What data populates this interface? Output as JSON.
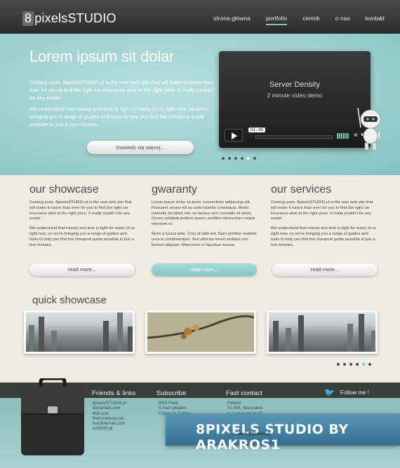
{
  "header": {
    "logo_number": "8",
    "logo_text": "pixelsSTUDIO",
    "nav": [
      {
        "label": "strona główna",
        "active": false
      },
      {
        "label": "portfolio",
        "active": true
      },
      {
        "label": "cennik",
        "active": false
      },
      {
        "label": "o nas",
        "active": false
      },
      {
        "label": "kontakt",
        "active": false
      }
    ]
  },
  "hero": {
    "title": "Lorem ipsum sit dolar",
    "p1": "Coming soon, 8pixelsSTUDIO.pl is the new web site that will make it easier than ever for you to find the right car insurance deal at the right price. It really couldn't be any easier.",
    "p2": "We understand that money and time is tight for many of us right now, so we're bringing you a range of guides and tools to help you find the cheapest quote possible in just a few minutes.",
    "cta": "Dowiedz się więcej...",
    "video": {
      "title": "Server Density",
      "subtitle": "2 minute video demo",
      "time": "01:48",
      "brand": "vi..."
    },
    "slider_dots": 6,
    "active_dot": 5
  },
  "columns": [
    {
      "title": "our showcase",
      "p1": "Coming soon, 8pixelsSTUDIO.pl is the new web site that will make it easier than ever for you to find the right car insurance deal at the right price. It really couldn't be any easier.",
      "p2": "We understand that money and time is tight for many of us right now, so we're bringing you a range of guides and tools to help you find the cheapest quote possible in just a few minutes.",
      "button": "read more..."
    },
    {
      "title": "gwaranty",
      "p1": "Lorem ipsum dolor sit amet, consectetur adipiscing elit. Praesent ornare elit eu ante lobortis consequat. Morbi molestie tincidunt nisi, eu lacinia sem convallis sit amet. Donec volutpat pretium ipsum, porttitor elementum neque interdum ut.",
      "p2": "Nunc a luctus ante. Cras id nibh est. Nam porttitor sodales urna in condimentum. Sed ultricies lorem sodales orci laoreet aliquam. Maecenas in faucibus massa.",
      "button": "read more..."
    },
    {
      "title": "our services",
      "p1": "Coming soon, 8pixelsSTUDIO.pl is the new web site that will make it easier than ever for you to find the right car insurance deal at the right price. It really couldn't be any easier.",
      "p2": "We understand that money and time is tight for many of us right now, so we're bringing you a range of guides and tools to help you find the cheapest quote possible in just a few minutes.",
      "button": "read more..."
    }
  ],
  "quick_showcase": {
    "title": "quick showcase",
    "slider_dots": 6,
    "active_dot": 5
  },
  "footer": {
    "friends_title": "Friends & links",
    "friends": [
      "8pixelsSTUDIO.pl",
      "deviantart.com",
      "8bit.com",
      "Retronemory.net",
      "buildinternet.com",
      "els5GIO.pl"
    ],
    "subscribe_title": "Subscribe",
    "subscribe": [
      "RSS Feed",
      "E-mail updates",
      "Follow on Twitter"
    ],
    "contact_title": "Fast contact",
    "contact": [
      "Poland",
      "01-494, Warszawa",
      "ul. Lorem ipsum 62"
    ],
    "mail_label": "mail:",
    "mail": "work@8pixels.pl",
    "twitter": "Follow me !",
    "banner": "8PIXELS STUDIO BY ARAKROS1"
  }
}
